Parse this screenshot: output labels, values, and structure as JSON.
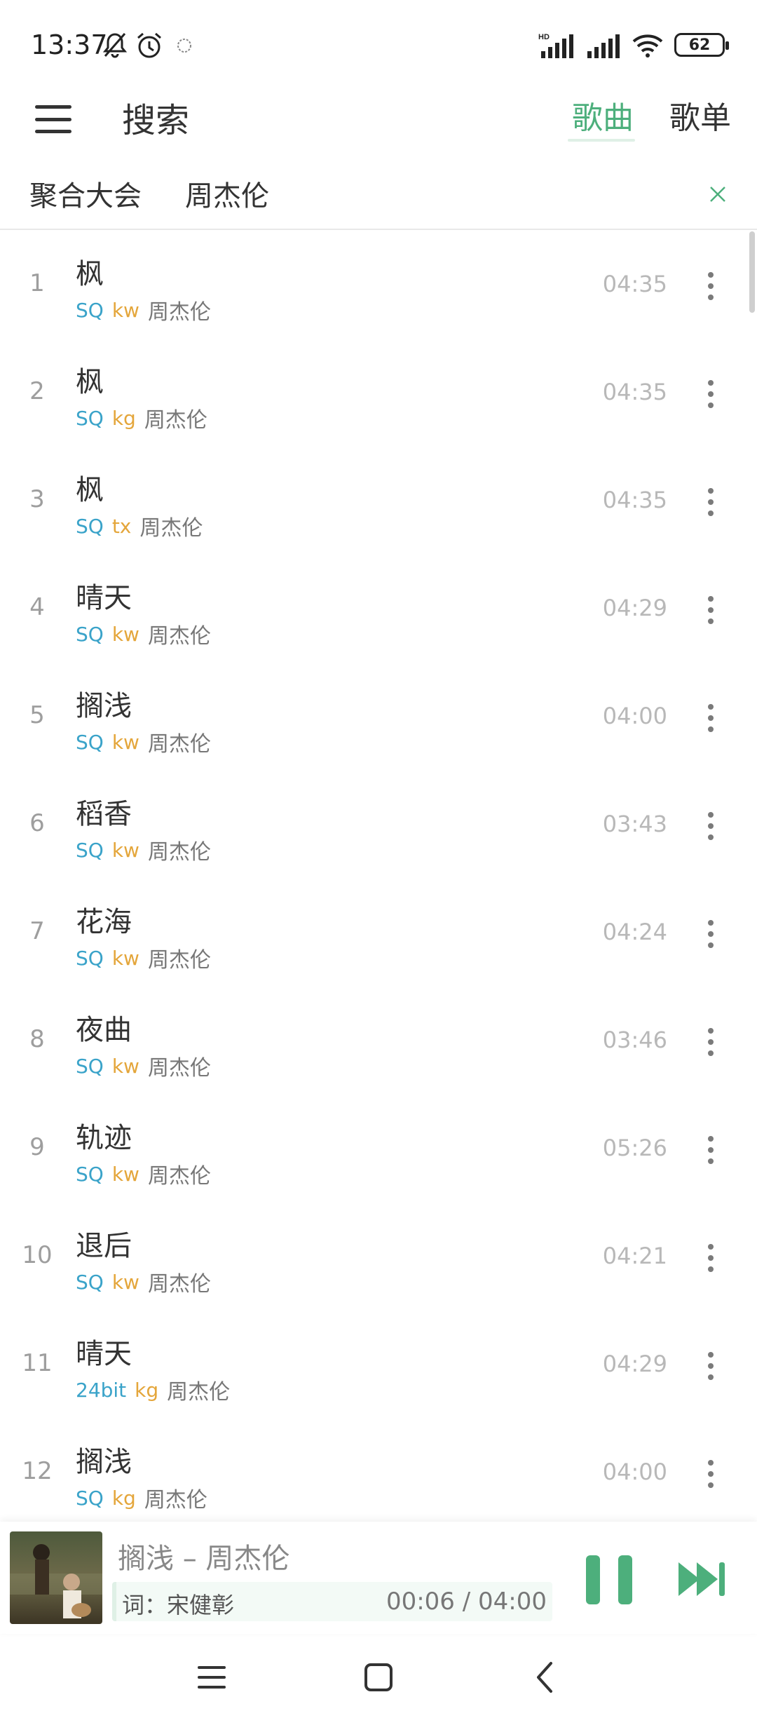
{
  "status_bar": {
    "time": "13:37",
    "battery": "62"
  },
  "header": {
    "title": "搜索",
    "tabs": [
      {
        "label": "歌曲"
      },
      {
        "label": "歌单"
      }
    ]
  },
  "search": {
    "source": "聚合大会",
    "query": "周杰伦"
  },
  "songs": [
    {
      "index": "1",
      "name": "枫",
      "quality": "SQ",
      "source": "kw",
      "artist": "周杰伦",
      "duration": "04:35"
    },
    {
      "index": "2",
      "name": "枫",
      "quality": "SQ",
      "source": "kg",
      "artist": "周杰伦",
      "duration": "04:35"
    },
    {
      "index": "3",
      "name": "枫",
      "quality": "SQ",
      "source": "tx",
      "artist": "周杰伦",
      "duration": "04:35"
    },
    {
      "index": "4",
      "name": "晴天",
      "quality": "SQ",
      "source": "kw",
      "artist": "周杰伦",
      "duration": "04:29"
    },
    {
      "index": "5",
      "name": "搁浅",
      "quality": "SQ",
      "source": "kw",
      "artist": "周杰伦",
      "duration": "04:00"
    },
    {
      "index": "6",
      "name": "稻香",
      "quality": "SQ",
      "source": "kw",
      "artist": "周杰伦",
      "duration": "03:43"
    },
    {
      "index": "7",
      "name": "花海",
      "quality": "SQ",
      "source": "kw",
      "artist": "周杰伦",
      "duration": "04:24"
    },
    {
      "index": "8",
      "name": "夜曲",
      "quality": "SQ",
      "source": "kw",
      "artist": "周杰伦",
      "duration": "03:46"
    },
    {
      "index": "9",
      "name": "轨迹",
      "quality": "SQ",
      "source": "kw",
      "artist": "周杰伦",
      "duration": "05:26"
    },
    {
      "index": "10",
      "name": "退后",
      "quality": "SQ",
      "source": "kw",
      "artist": "周杰伦",
      "duration": "04:21"
    },
    {
      "index": "11",
      "name": "晴天",
      "quality": "24bit",
      "source": "kg",
      "artist": "周杰伦",
      "duration": "04:29"
    },
    {
      "index": "12",
      "name": "搁浅",
      "quality": "SQ",
      "source": "kg",
      "artist": "周杰伦",
      "duration": "04:00"
    }
  ],
  "player": {
    "title": "搁浅 – 周杰伦",
    "lyric": "词：宋健彰",
    "time": "00:06 / 04:00"
  },
  "colors": {
    "accent": "#4daf7c",
    "quality": "#3aa3c9",
    "source": "#e4a63b"
  },
  "icons": [
    "bell-off-icon",
    "alarm-icon",
    "signal-icon",
    "wifi-icon",
    "battery-icon",
    "menu-icon",
    "close-icon",
    "more-icon",
    "pause-icon",
    "next-icon",
    "nav-menu-icon",
    "nav-home-icon",
    "nav-back-icon"
  ]
}
